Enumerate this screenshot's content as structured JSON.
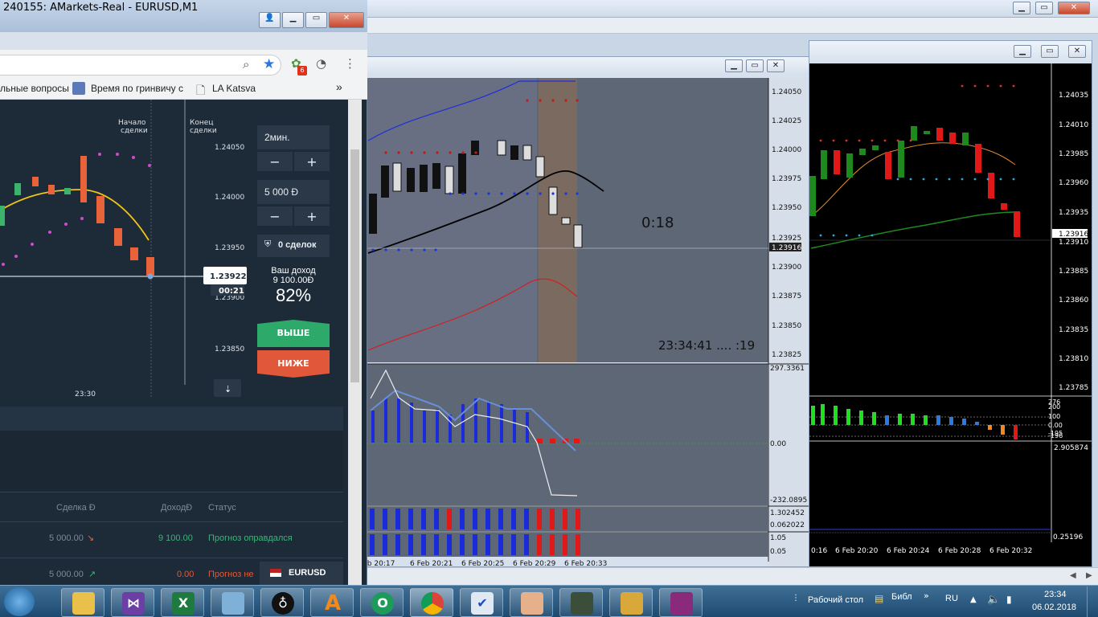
{
  "mt4": {
    "mid": {
      "price_labels": [
        "1.24050",
        "1.24025",
        "1.24000",
        "1.23975",
        "1.23950",
        "1.23925",
        "1.23916",
        "1.23900",
        "1.23875",
        "1.23850",
        "1.23825"
      ],
      "countdown": "0:18",
      "clock": "23:34:41 ....  :19",
      "ind1_labels": [
        "297.3361",
        "0.00",
        "-232.0895"
      ],
      "ind2_labels": [
        "1.302452",
        "0.062022"
      ],
      "ind3_labels": [
        "1.05",
        "0.05"
      ],
      "time_labels": [
        "6 Feb 20:17",
        "6 Feb 20:21",
        "6 Feb 20:25",
        "6 Feb 20:29",
        "6 Feb 20:33"
      ]
    },
    "right": {
      "price_labels": [
        "1.24035",
        "1.24010",
        "1.23985",
        "1.23960",
        "1.23935",
        "1.23916",
        "1.23910",
        "1.23885",
        "1.23860",
        "1.23835",
        "1.23810",
        "1.23785"
      ],
      "ind1_labels": [
        "276",
        "200",
        "100",
        "0.00",
        "-195",
        "-196"
      ],
      "ind2_label": "2.905874",
      "ind3_label": "0.25196",
      "time_labels": [
        "0:16",
        "6 Feb 20:20",
        "6 Feb 20:24",
        "6 Feb 20:28",
        "6 Feb 20:32"
      ]
    }
  },
  "browser": {
    "title": "240155: AMarkets-Real - EURUSD,M1",
    "notif_count": "6",
    "bookmarks": [
      "льные вопросы",
      "Время по гринвичу с",
      "LA Katsva"
    ],
    "more": "»",
    "chart": {
      "labels": [
        "Начало",
        "сделки",
        "Конец",
        "сделки"
      ],
      "price_labels": [
        "1.24050",
        "1.24000",
        "1.23950",
        "1.23900",
        "1.23850"
      ],
      "current_price": "1.23922",
      "current_timer": "00:21",
      "time_label": "23:30"
    },
    "panel": {
      "duration": "2мин.",
      "amount": "5 000 Ð",
      "minus": "−",
      "plus": "+",
      "deals": "0 сделок",
      "income_label": "Ваш доход",
      "income_value": "9 100.00Ð",
      "percent": "82%",
      "up_label": "ВЫШЕ",
      "down_label": "НИЖЕ"
    },
    "table": {
      "headers": [
        "Сделка Ð",
        "ДоходÐ",
        "Статус"
      ],
      "rows": [
        {
          "deal": "5 000.00",
          "income": "9 100.00",
          "status": "Прогноз оправдался",
          "income_color": "#3fb37a"
        },
        {
          "deal": "5 000.00",
          "income": "0.00",
          "status": "Прогноз не",
          "income_color": "#e05a3a"
        }
      ],
      "asset": "EURUSD"
    }
  },
  "taskbar": {
    "desktop_label": "Рабочий стол",
    "lib_label": "Библ",
    "lang": "RU",
    "time": "23:34",
    "date": "06.02.2018"
  }
}
